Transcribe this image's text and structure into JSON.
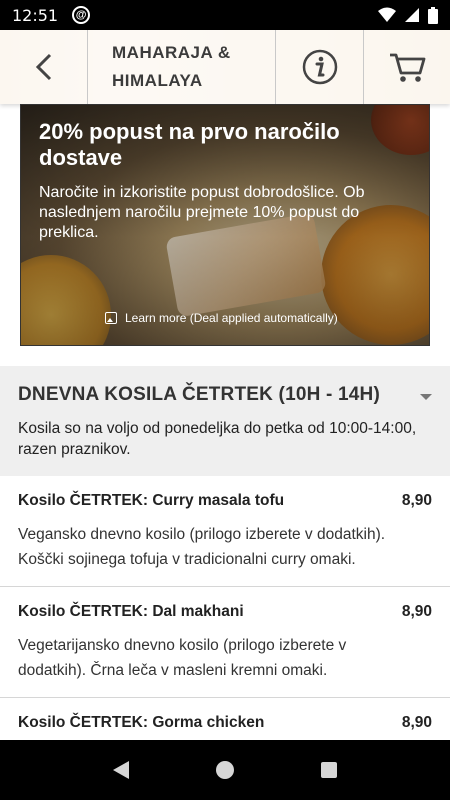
{
  "status": {
    "time": "12:51"
  },
  "header": {
    "title_line1": "MAHARAJA &",
    "title_line2": "HIMALAYA"
  },
  "promo": {
    "headline": "20% popust na prvo naročilo dostave",
    "description": "Naročite in izkoristite popust dobrodošlice. Ob naslednjem naročilu prejmete 10% popust do preklica.",
    "learn_more": "Learn more (Deal applied automatically)"
  },
  "category": {
    "title": "DNEVNA KOSILA ČETRTEK (10H - 14H)",
    "description": "Kosila so na voljo od ponedeljka do petka od 10:00-14:00, razen praznikov."
  },
  "menu": {
    "items": [
      {
        "name": "Kosilo ČETRTEK: Curry masala tofu",
        "price": "8,90",
        "description": "Vegansko dnevno kosilo (prilogo izberete v dodatkih). Koščki sojinega tofuja v tradicionalni curry omaki."
      },
      {
        "name": "Kosilo ČETRTEK: Dal makhani",
        "price": "8,90",
        "description": "Vegetarijansko dnevno kosilo (prilogo izberete v dodatkih). Črna leča v masleni kremni omaki."
      },
      {
        "name": "Kosilo ČETRTEK: Gorma chicken",
        "price": "8,90",
        "description": ""
      }
    ]
  },
  "icons": {
    "status": [
      "at-icon",
      "wifi-icon",
      "signal-icon",
      "battery-icon"
    ],
    "header": [
      "back-arrow-icon",
      "info-icon",
      "cart-icon"
    ],
    "nav": [
      "nav-back-icon",
      "nav-home-icon",
      "nav-recents-icon"
    ]
  }
}
